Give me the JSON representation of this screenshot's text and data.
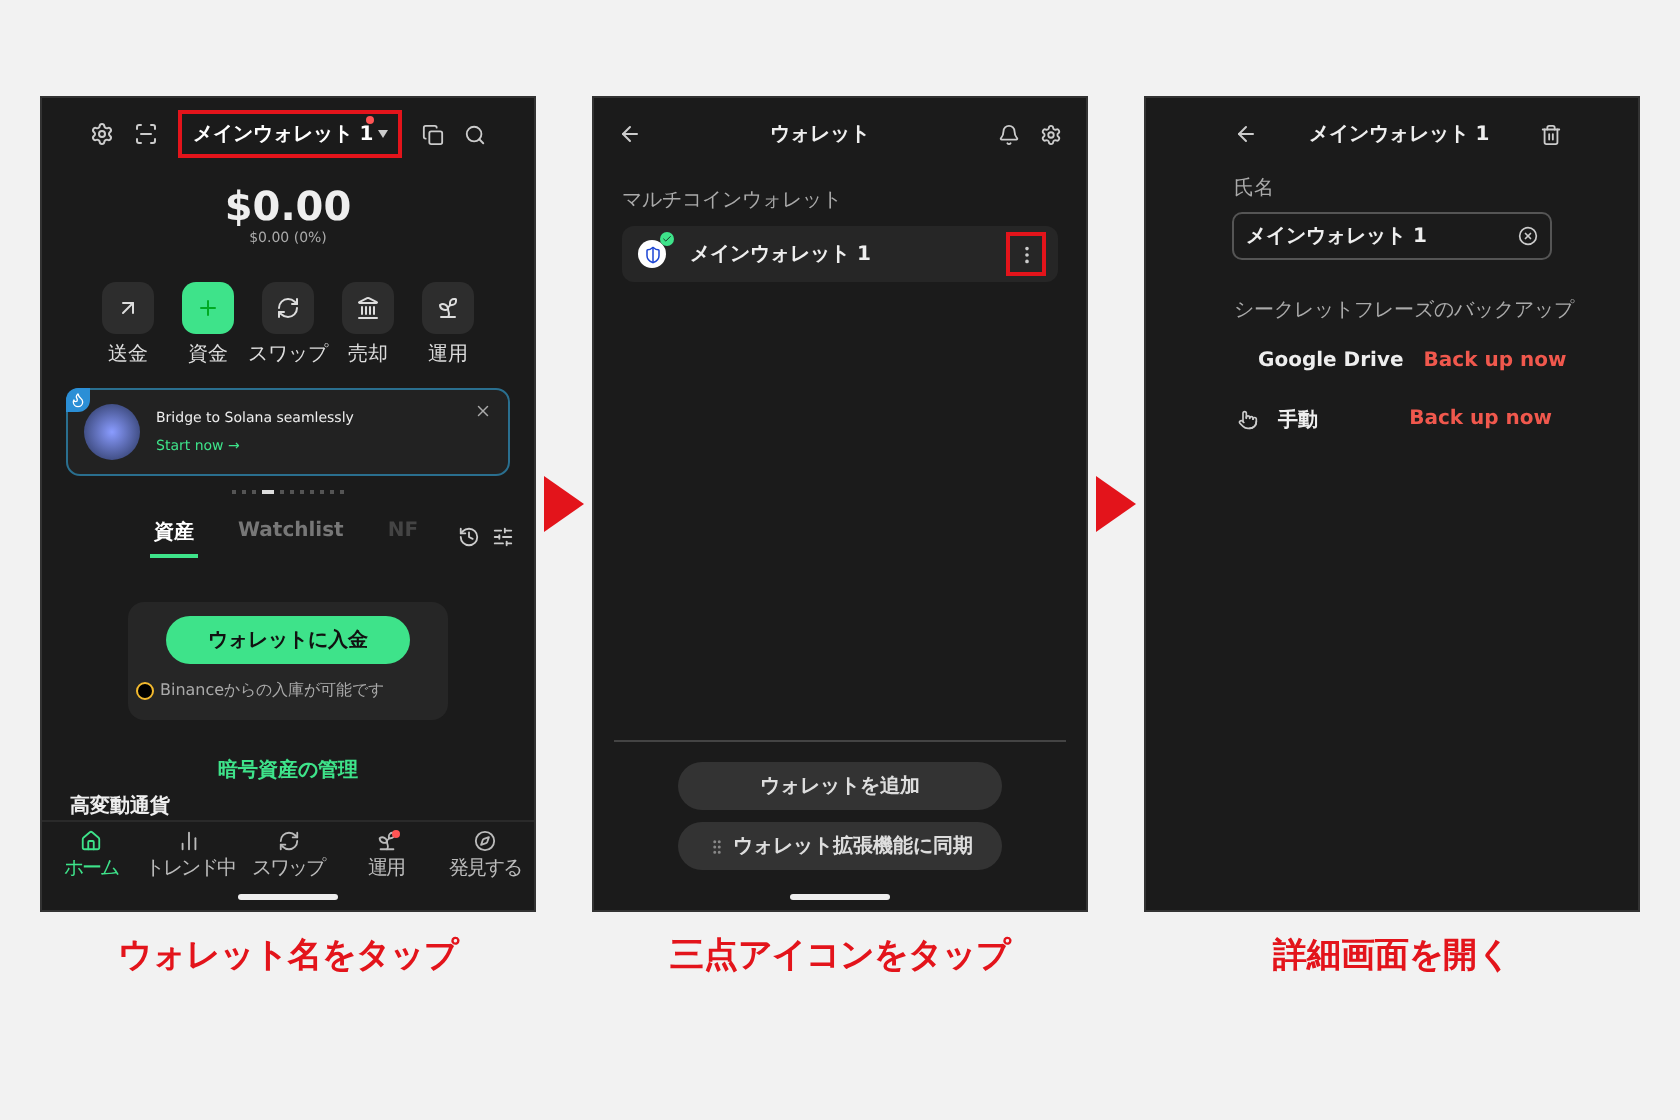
{
  "home": {
    "wallet_name": "メインウォレット 1",
    "wallet_badge": true,
    "highlighted": true,
    "balance": "$0.00",
    "change": "$0.00 (0%)",
    "actions": [
      {
        "label": "送金",
        "kind": "send",
        "primary": false
      },
      {
        "label": "資金",
        "kind": "add",
        "primary": true
      },
      {
        "label": "スワップ",
        "kind": "swap",
        "primary": false
      },
      {
        "label": "売却",
        "kind": "sell",
        "primary": false
      },
      {
        "label": "運用",
        "kind": "earn",
        "primary": false
      }
    ],
    "banner": {
      "title": "Bridge to Solana seamlessly",
      "link": "Start now →"
    },
    "pager": [
      {
        "selected": false
      },
      {
        "selected": false
      },
      {
        "selected": false
      },
      {
        "selected": true
      },
      {
        "selected": false
      },
      {
        "selected": false
      },
      {
        "selected": false
      },
      {
        "selected": false
      },
      {
        "selected": false
      },
      {
        "selected": false
      },
      {
        "selected": false
      }
    ],
    "tabs": [
      {
        "label": "資産",
        "selected": true,
        "faded": false
      },
      {
        "label": "Watchlist",
        "selected": false,
        "faded": false
      },
      {
        "label": "NF",
        "selected": false,
        "faded": true
      }
    ],
    "deposit": {
      "button": "ウォレットに入金",
      "note": "Binanceからの入庫が可能です"
    },
    "manage_link": "暗号資産の管理",
    "section": "高変動通貨",
    "nav": [
      {
        "label": "ホーム",
        "kind": "home",
        "selected": true,
        "badge": false
      },
      {
        "label": "トレンド中",
        "kind": "trend",
        "selected": false,
        "badge": false
      },
      {
        "label": "スワップ",
        "kind": "swap",
        "selected": false,
        "badge": false
      },
      {
        "label": "運用",
        "kind": "earn",
        "selected": false,
        "badge": true
      },
      {
        "label": "発見する",
        "kind": "discover",
        "selected": false,
        "badge": false
      }
    ]
  },
  "wallets": {
    "title": "ウォレット",
    "section": "マルチコインウォレット",
    "items": [
      {
        "name": "メインウォレット 1",
        "selected": true,
        "menu_highlighted": true
      }
    ],
    "buttons": [
      {
        "label": "ウォレットを追加",
        "kind": "add"
      },
      {
        "label": "ウォレット拡張機能に同期",
        "kind": "sync"
      }
    ]
  },
  "detail": {
    "title": "メインウォレット 1",
    "field_label": "氏名",
    "field_value": "メインウォレット 1",
    "section": "シークレットフレーズのバックアップ",
    "backups": [
      {
        "label": "Google Drive",
        "kind": "drive",
        "action": "Back up now"
      },
      {
        "label": "手動",
        "kind": "manual",
        "action": "Back up now"
      }
    ]
  },
  "captions": [
    "ウォレット名をタップ",
    "三点アイコンをタップ",
    "詳細画面を開く"
  ]
}
